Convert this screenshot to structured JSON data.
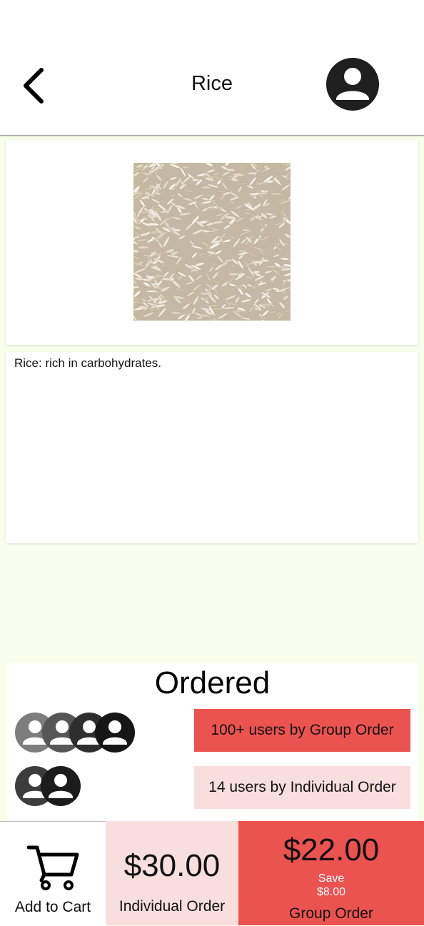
{
  "header": {
    "title": "Rice",
    "back_icon": "chevron-left-icon",
    "profile_icon": "account-circle-icon"
  },
  "product": {
    "image_alt": "rice grains",
    "description": "Rice: rich in carbohydrates."
  },
  "ordered": {
    "title": "Ordered",
    "group_text": "100+ users by Group Order",
    "individual_text": "14 users by Individual Order"
  },
  "bottom_bar": {
    "cart_label": "Add to Cart",
    "individual_price": "$30.00",
    "individual_label": "Individual Order",
    "group_price": "$22.00",
    "save_label": "Save",
    "save_amount": "$8.00",
    "group_label": "Group Order"
  },
  "colors": {
    "background": "#f9fdeb",
    "group_accent": "#eb5350",
    "individual_accent": "#f9dede"
  }
}
